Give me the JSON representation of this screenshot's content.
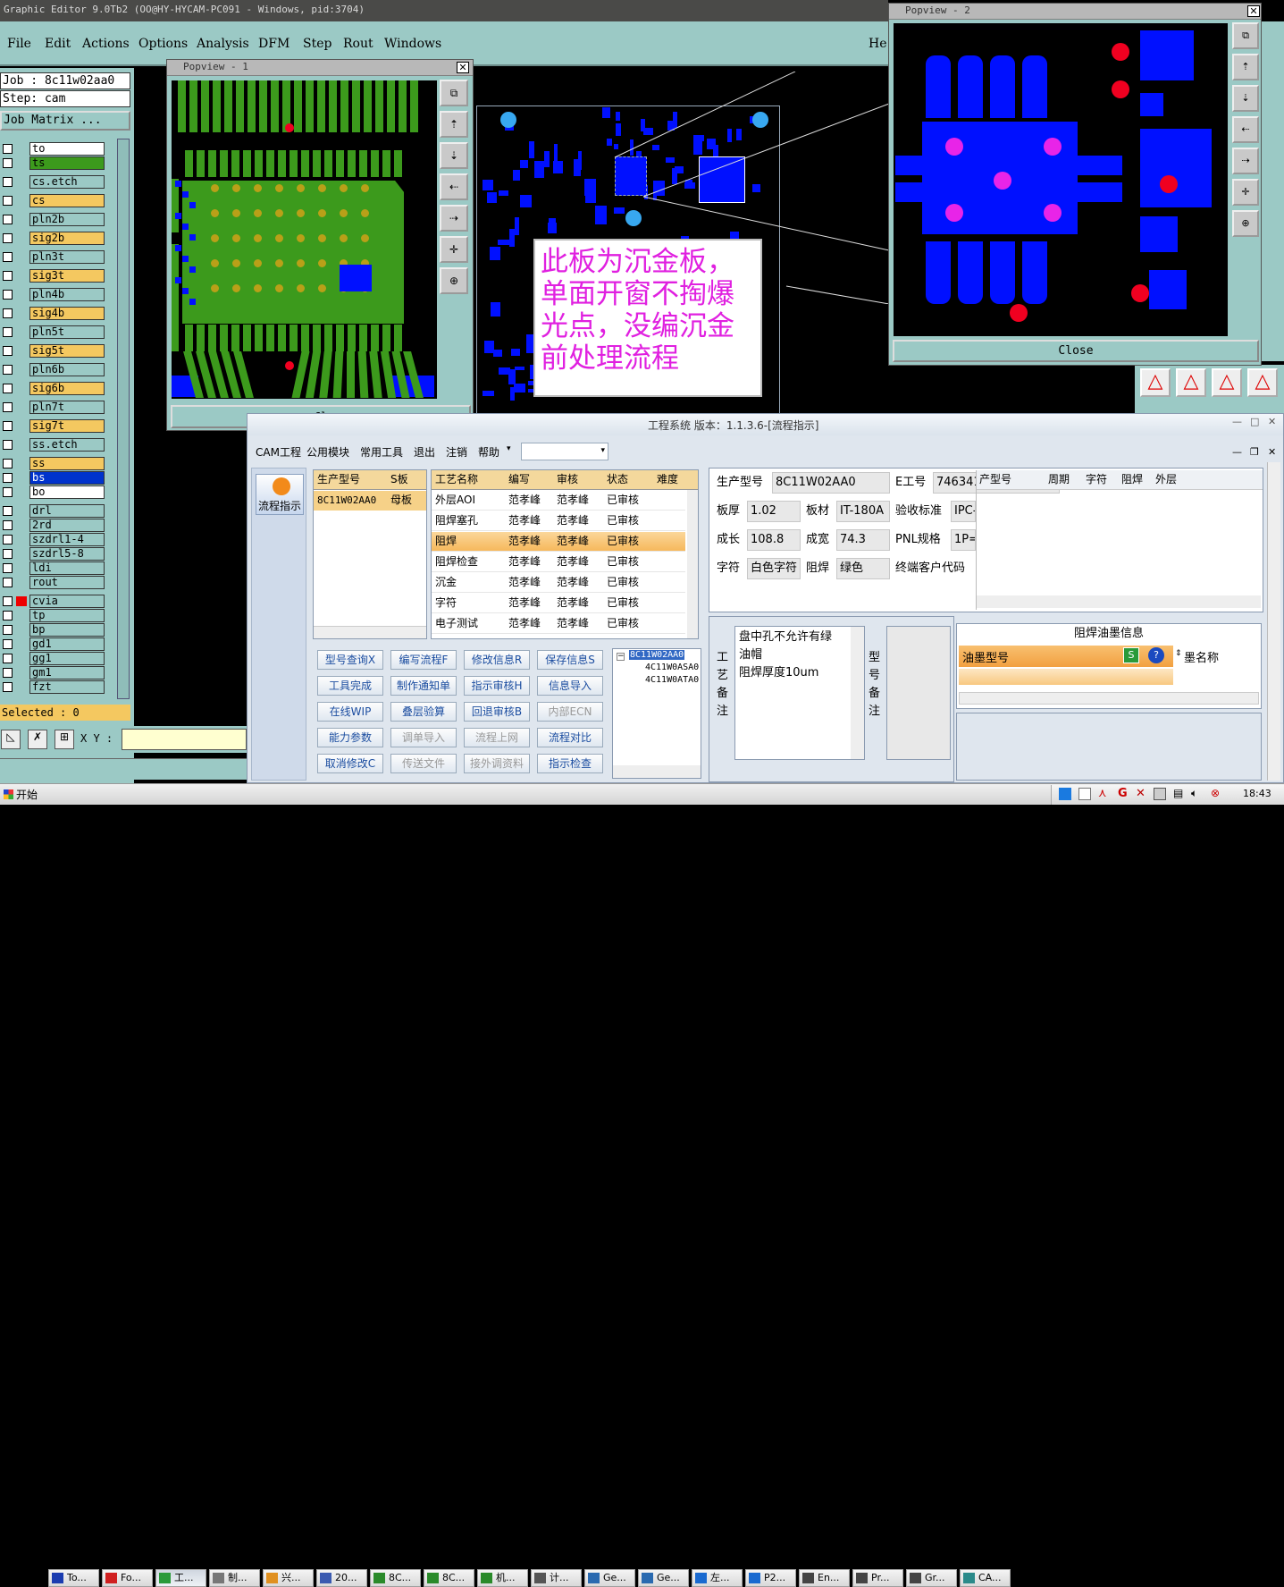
{
  "main_window": {
    "title": "Graphic Editor 9.0Tb2 (OO@HY-HYCAM-PC091 - Windows, pid:3704)",
    "menu": [
      "File",
      "Edit",
      "Actions",
      "Options",
      "Analysis",
      "DFM",
      "Step",
      "Rout",
      "Windows"
    ],
    "menu_right": "He",
    "job_label": "Job : 8c11w02aa0",
    "step_label": "Step: cam",
    "job_matrix": "Job Matrix ...",
    "layers": [
      "to",
      "ts",
      "cs.etch",
      "cs",
      "pln2b",
      "sig2b",
      "pln3t",
      "sig3t",
      "pln4b",
      "sig4b",
      "pln5t",
      "sig5t",
      "pln6b",
      "sig6b",
      "pln7t",
      "sig7t",
      "ss.etch",
      "ss",
      "bs",
      "bo",
      "drl",
      "2rd",
      "szdrl1-4",
      "szdrl5-8",
      "ldi",
      "rout",
      "cvia",
      "tp",
      "bp",
      "gd1",
      "gg1",
      "gm1",
      "fzt"
    ],
    "selected": "Selected : 0",
    "xy_label": "X Y :",
    "annotation": "此板为沉金板，单面开窗不掏爆光点，没编沉金前处理流程"
  },
  "popview1": {
    "title": "Popview - 1",
    "bottom_label": "Cl"
  },
  "popview2": {
    "title": "Popview - 2",
    "close_label": "Close"
  },
  "eng_system": {
    "title": "工程系统 版本：1.1.3.6-[流程指示]",
    "menu": [
      "CAM工程",
      "公用模块",
      "常用工具",
      "退出",
      "注销",
      "帮助"
    ],
    "side_label": "流程指示",
    "product_table": {
      "headers": [
        "生产型号",
        "S板"
      ],
      "rows": [
        [
          "8C11W02AA0",
          "母板"
        ]
      ]
    },
    "process_table": {
      "headers": [
        "工艺名称",
        "编写",
        "审核",
        "状态",
        "难度"
      ],
      "rows": [
        [
          "外层AOI",
          "范孝峰",
          "范孝峰",
          "已审核"
        ],
        [
          "阻焊塞孔",
          "范孝峰",
          "范孝峰",
          "已审核"
        ],
        [
          "阻焊",
          "范孝峰",
          "范孝峰",
          "已审核"
        ],
        [
          "阻焊检查",
          "范孝峰",
          "范孝峰",
          "已审核"
        ],
        [
          "沉金",
          "范孝峰",
          "范孝峰",
          "已审核"
        ],
        [
          "字符",
          "范孝峰",
          "范孝峰",
          "已审核"
        ],
        [
          "电子测试",
          "范孝峰",
          "范孝峰",
          "已审核"
        ]
      ]
    },
    "buttons": [
      [
        "型号查询X",
        "编写流程F",
        "修改信息R",
        "保存信息S"
      ],
      [
        "工具完成",
        "制作通知单",
        "指示审核H",
        "信息导入"
      ],
      [
        "在线WIP",
        "叠层验算",
        "回退审核B",
        "内部ECN"
      ],
      [
        "能力参数",
        "调单导入",
        "流程上网",
        "流程对比"
      ],
      [
        "取消修改C",
        "传送文件",
        "接外调资料",
        "指示检查"
      ]
    ],
    "tree": [
      "8C11W02AA0",
      "4C11W0ASA0",
      "4C11W0ATA0"
    ],
    "info": {
      "prod_model_label": "生产型号",
      "prod_model": "8C11W02AA0",
      "eno_label": "E工号",
      "eno": "746341",
      "thickness_label": "板厚",
      "thickness": "1.02",
      "material_label": "板材",
      "material": "IT-180A",
      "accept_label": "验收标准",
      "accept": "IPC-",
      "length_label": "成长",
      "length": "108.8",
      "width_label": "成宽",
      "width": "74.3",
      "pnl_label": "PNL规格",
      "pnl": "1P=",
      "char_label": "字符",
      "char": "白色字符",
      "mask_label": "阻焊",
      "mask": "绿色",
      "customer_label": "终端客户代码",
      "right_headers": [
        "产型号",
        "周期",
        "字符",
        "阻焊",
        "外层"
      ]
    },
    "remarks": {
      "process_label": [
        "工",
        "艺",
        "备",
        "注"
      ],
      "process_text": [
        "盘中孔不允许有绿",
        "油帽",
        "阻焊厚度10um"
      ],
      "model_label": [
        "型",
        "号",
        "备",
        "注"
      ]
    },
    "ink": {
      "title": "阻焊油墨信息",
      "col1": "油墨型号",
      "col2": "墨名称"
    }
  },
  "taskbar": {
    "start": "开始",
    "items": [
      "To...",
      "Fo...",
      "工...",
      "制...",
      "兴...",
      "20...",
      "8C...",
      "8C...",
      "机...",
      "计...",
      "Ge...",
      "Ge...",
      "左...",
      "P2...",
      "En...",
      "Pr...",
      "Gr...",
      "CA..."
    ],
    "clock": "18:43"
  }
}
